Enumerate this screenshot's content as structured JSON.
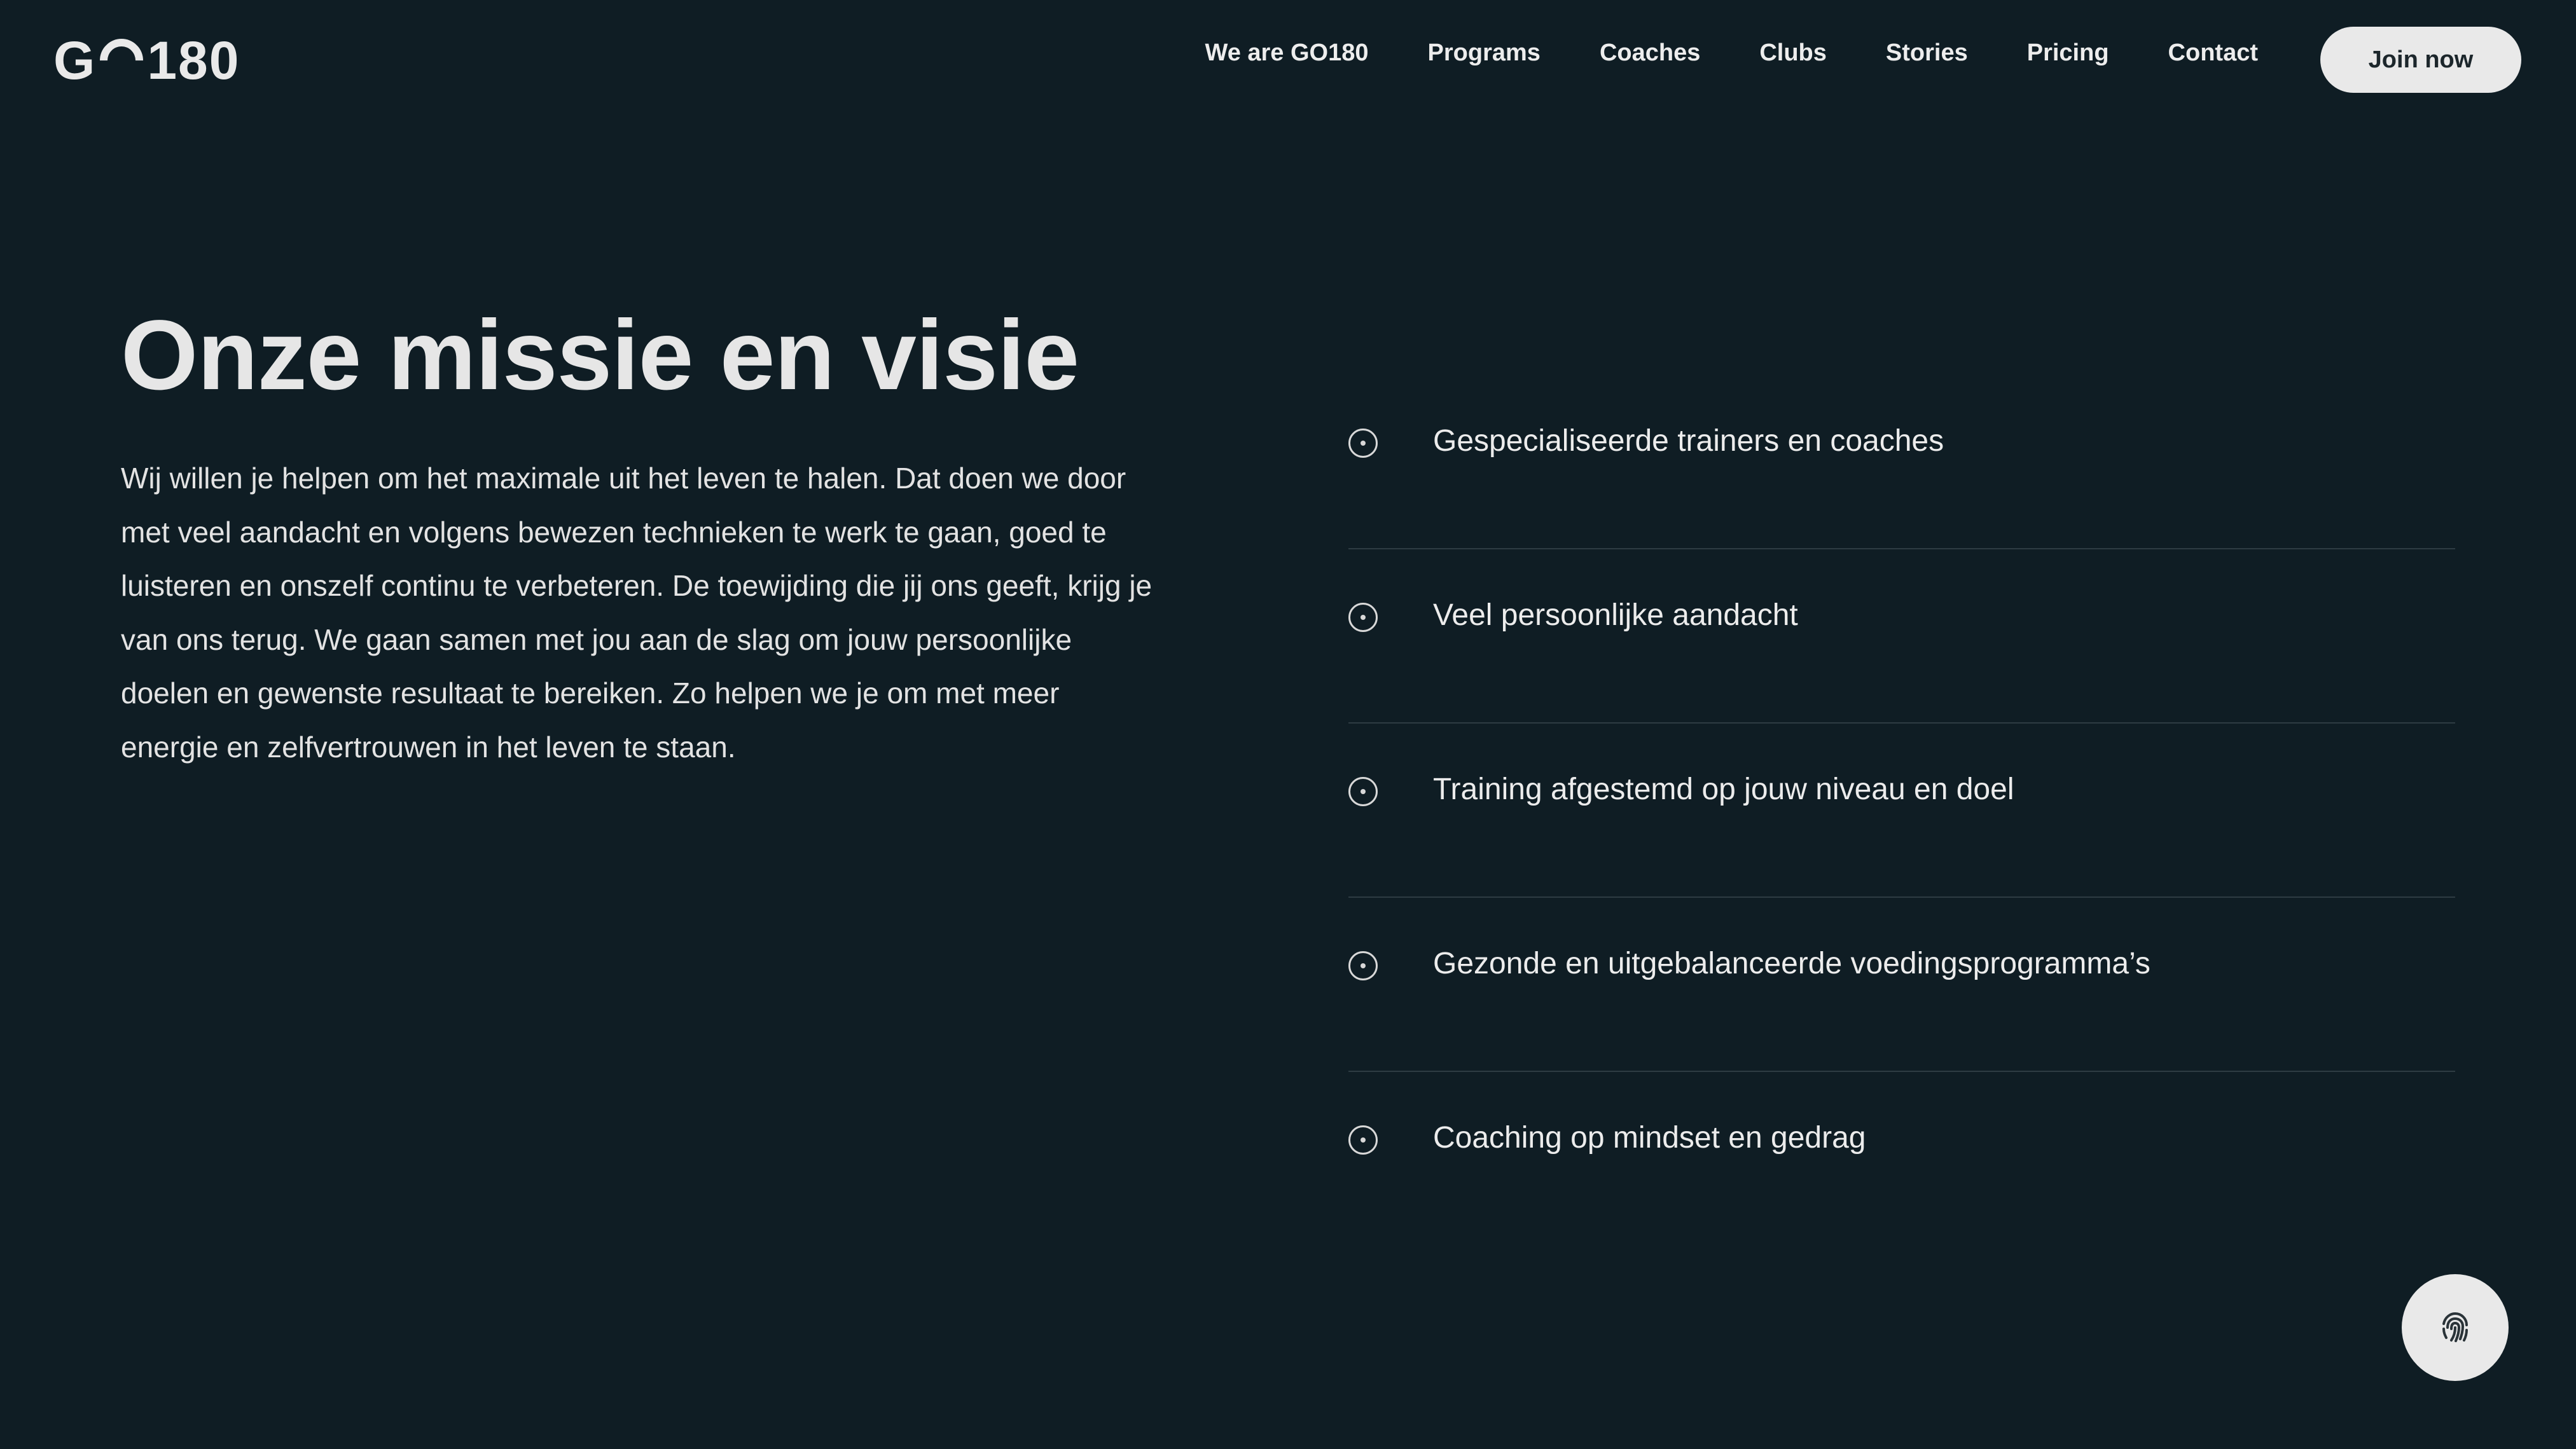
{
  "header": {
    "logo_left": "G",
    "logo_right": "180",
    "nav": [
      {
        "label": "We are GO180"
      },
      {
        "label": "Programs"
      },
      {
        "label": "Coaches"
      },
      {
        "label": "Clubs"
      },
      {
        "label": "Stories"
      },
      {
        "label": "Pricing"
      },
      {
        "label": "Contact"
      }
    ],
    "join_label": "Join now"
  },
  "main": {
    "title": "Onze missie en visie",
    "body": "Wij willen je helpen om het maximale uit het leven te halen. Dat doen we door met veel aandacht en volgens bewezen technieken te werk te gaan, goed te luisteren en onszelf continu te verbeteren. De toewijding die jij ons geeft, krijg je van ons terug. We gaan samen met jou aan de slag om jouw persoonlijke doelen en gewenste resultaat te bereiken. Zo helpen we je om met meer energie en zelfvertrouwen in het leven te staan.",
    "features": [
      {
        "label": "Gespecialiseerde trainers en coaches"
      },
      {
        "label": "Veel persoonlijke aandacht"
      },
      {
        "label": "Training afgestemd op jouw niveau en doel"
      },
      {
        "label": "Gezonde en uitgebalanceerde voedingsprogramma’s"
      },
      {
        "label": "Coaching op mindset en gedrag"
      }
    ]
  },
  "floating": {
    "icon": "fingerprint-icon"
  },
  "colors": {
    "background": "#0f1d24",
    "text": "#e6e6e6",
    "button_bg": "#e9e9e9",
    "button_text": "#1c262b",
    "divider": "#2e3c43"
  }
}
